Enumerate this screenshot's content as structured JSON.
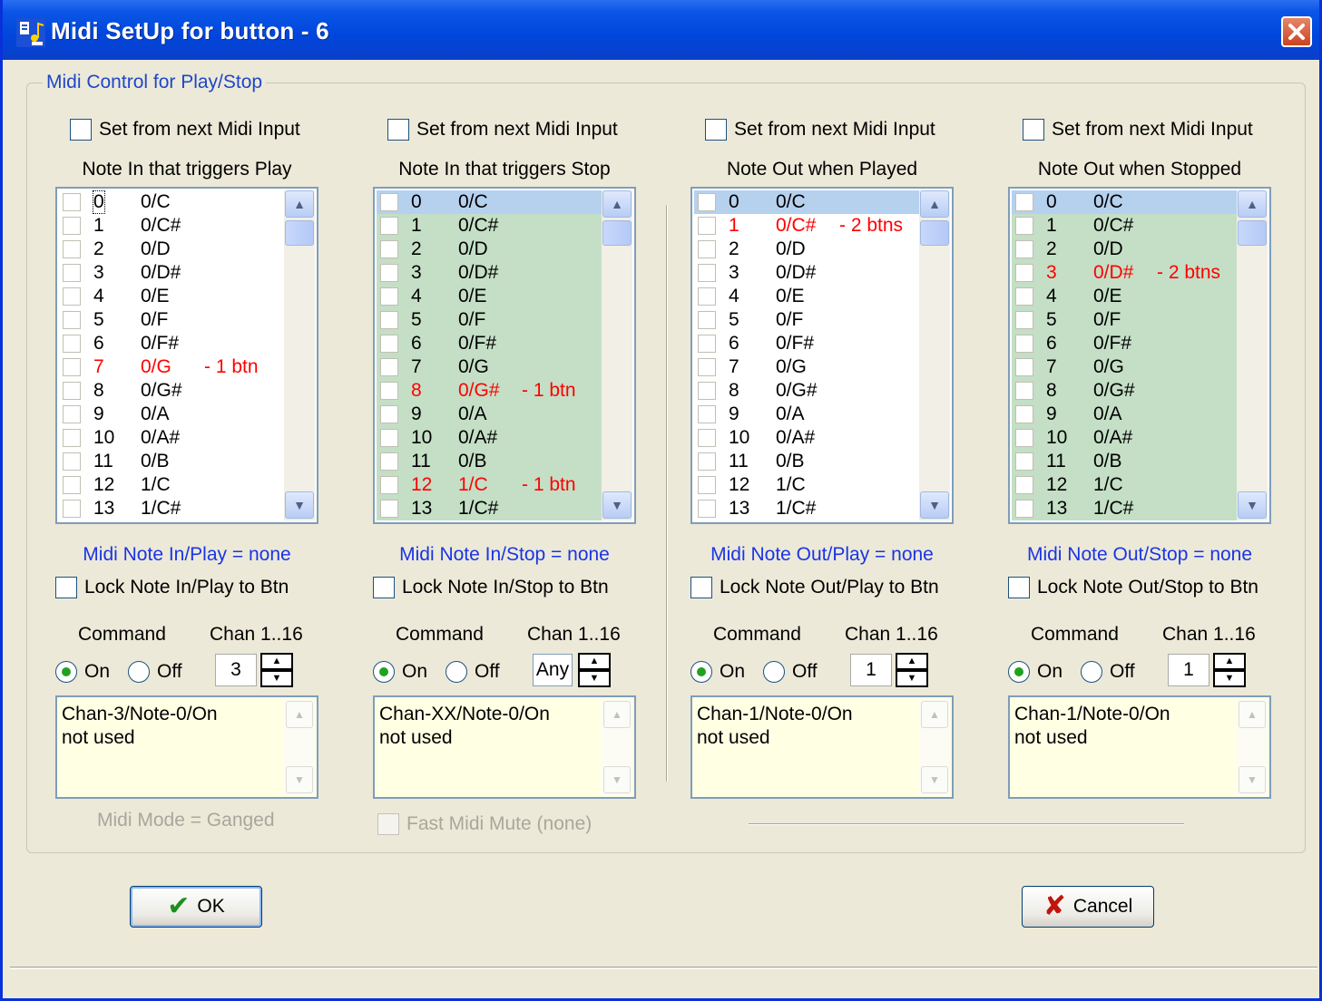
{
  "window": {
    "title": "Midi SetUp for button - 6",
    "title_color": "#0046dc"
  },
  "group": {
    "label": "Midi Control for Play/Stop"
  },
  "columns": [
    {
      "set_from_label": "Set from next Midi Input",
      "heading": "Note In that triggers Play",
      "list": [
        {
          "num": "0",
          "note": "0/C",
          "extra": ""
        },
        {
          "num": "1",
          "note": "0/C#",
          "extra": ""
        },
        {
          "num": "2",
          "note": "0/D",
          "extra": ""
        },
        {
          "num": "3",
          "note": "0/D#",
          "extra": ""
        },
        {
          "num": "4",
          "note": "0/E",
          "extra": ""
        },
        {
          "num": "5",
          "note": "0/F",
          "extra": ""
        },
        {
          "num": "6",
          "note": "0/F#",
          "extra": ""
        },
        {
          "num": "7",
          "note": "0/G",
          "extra": "- 1 btn"
        },
        {
          "num": "8",
          "note": "0/G#",
          "extra": ""
        },
        {
          "num": "9",
          "note": "0/A",
          "extra": ""
        },
        {
          "num": "10",
          "note": "0/A#",
          "extra": ""
        },
        {
          "num": "11",
          "note": "0/B",
          "extra": ""
        },
        {
          "num": "12",
          "note": "1/C",
          "extra": ""
        },
        {
          "num": "13",
          "note": "1/C#",
          "extra": ""
        }
      ],
      "status": "Midi Note In/Play = none",
      "lock_label": "Lock Note In/Play to Btn",
      "command_label": "Command",
      "chan_label": "Chan 1..16",
      "on_label": "On",
      "off_label": "Off",
      "chan_value": "3",
      "memo_line1": "Chan-3/Note-0/On",
      "memo_line2": "not used"
    },
    {
      "set_from_label": "Set from next Midi Input",
      "heading": "Note In that triggers Stop",
      "list": [
        {
          "num": "0",
          "note": "0/C",
          "extra": ""
        },
        {
          "num": "1",
          "note": "0/C#",
          "extra": ""
        },
        {
          "num": "2",
          "note": "0/D",
          "extra": ""
        },
        {
          "num": "3",
          "note": "0/D#",
          "extra": ""
        },
        {
          "num": "4",
          "note": "0/E",
          "extra": ""
        },
        {
          "num": "5",
          "note": "0/F",
          "extra": ""
        },
        {
          "num": "6",
          "note": "0/F#",
          "extra": ""
        },
        {
          "num": "7",
          "note": "0/G",
          "extra": ""
        },
        {
          "num": "8",
          "note": "0/G#",
          "extra": "- 1 btn"
        },
        {
          "num": "9",
          "note": "0/A",
          "extra": ""
        },
        {
          "num": "10",
          "note": "0/A#",
          "extra": ""
        },
        {
          "num": "11",
          "note": "0/B",
          "extra": ""
        },
        {
          "num": "12",
          "note": "1/C",
          "extra": "- 1 btn"
        },
        {
          "num": "13",
          "note": "1/C#",
          "extra": ""
        }
      ],
      "status": "Midi Note In/Stop = none",
      "lock_label": "Lock Note In/Stop to Btn",
      "command_label": "Command",
      "chan_label": "Chan 1..16",
      "on_label": "On",
      "off_label": "Off",
      "chan_value": "Any",
      "memo_line1": "Chan-XX/Note-0/On",
      "memo_line2": "not used"
    },
    {
      "set_from_label": "Set from next Midi Input",
      "heading": "Note Out when Played",
      "list": [
        {
          "num": "0",
          "note": "0/C",
          "extra": ""
        },
        {
          "num": "1",
          "note": "0/C#",
          "extra": "- 2 btns"
        },
        {
          "num": "2",
          "note": "0/D",
          "extra": ""
        },
        {
          "num": "3",
          "note": "0/D#",
          "extra": ""
        },
        {
          "num": "4",
          "note": "0/E",
          "extra": ""
        },
        {
          "num": "5",
          "note": "0/F",
          "extra": ""
        },
        {
          "num": "6",
          "note": "0/F#",
          "extra": ""
        },
        {
          "num": "7",
          "note": "0/G",
          "extra": ""
        },
        {
          "num": "8",
          "note": "0/G#",
          "extra": ""
        },
        {
          "num": "9",
          "note": "0/A",
          "extra": ""
        },
        {
          "num": "10",
          "note": "0/A#",
          "extra": ""
        },
        {
          "num": "11",
          "note": "0/B",
          "extra": ""
        },
        {
          "num": "12",
          "note": "1/C",
          "extra": ""
        },
        {
          "num": "13",
          "note": "1/C#",
          "extra": ""
        }
      ],
      "status": "Midi Note Out/Play = none",
      "lock_label": "Lock Note Out/Play to Btn",
      "command_label": "Command",
      "chan_label": "Chan 1..16",
      "on_label": "On",
      "off_label": "Off",
      "chan_value": "1",
      "memo_line1": "Chan-1/Note-0/On",
      "memo_line2": "not used"
    },
    {
      "set_from_label": "Set from next Midi Input",
      "heading": "Note Out when Stopped",
      "list": [
        {
          "num": "0",
          "note": "0/C",
          "extra": ""
        },
        {
          "num": "1",
          "note": "0/C#",
          "extra": ""
        },
        {
          "num": "2",
          "note": "0/D",
          "extra": ""
        },
        {
          "num": "3",
          "note": "0/D#",
          "extra": "- 2 btns"
        },
        {
          "num": "4",
          "note": "0/E",
          "extra": ""
        },
        {
          "num": "5",
          "note": "0/F",
          "extra": ""
        },
        {
          "num": "6",
          "note": "0/F#",
          "extra": ""
        },
        {
          "num": "7",
          "note": "0/G",
          "extra": ""
        },
        {
          "num": "8",
          "note": "0/G#",
          "extra": ""
        },
        {
          "num": "9",
          "note": "0/A",
          "extra": ""
        },
        {
          "num": "10",
          "note": "0/A#",
          "extra": ""
        },
        {
          "num": "11",
          "note": "0/B",
          "extra": ""
        },
        {
          "num": "12",
          "note": "1/C",
          "extra": ""
        },
        {
          "num": "13",
          "note": "1/C#",
          "extra": ""
        }
      ],
      "status": "Midi Note Out/Stop = none",
      "lock_label": "Lock Note Out/Stop to Btn",
      "command_label": "Command",
      "chan_label": "Chan 1..16",
      "on_label": "On",
      "off_label": "Off",
      "chan_value": "1",
      "memo_line1": "Chan-1/Note-0/On",
      "memo_line2": "not used"
    }
  ],
  "midi_mode": "Midi Mode = Ganged",
  "fast_mute": "Fast Midi Mute (none)",
  "buttons": {
    "ok": "OK",
    "cancel": "Cancel"
  },
  "colors": {
    "status_blue": "#1a35e6",
    "marked_red": "#ff0000",
    "green_list": "#c4dfc6",
    "memo_bg": "#ffffe4"
  }
}
